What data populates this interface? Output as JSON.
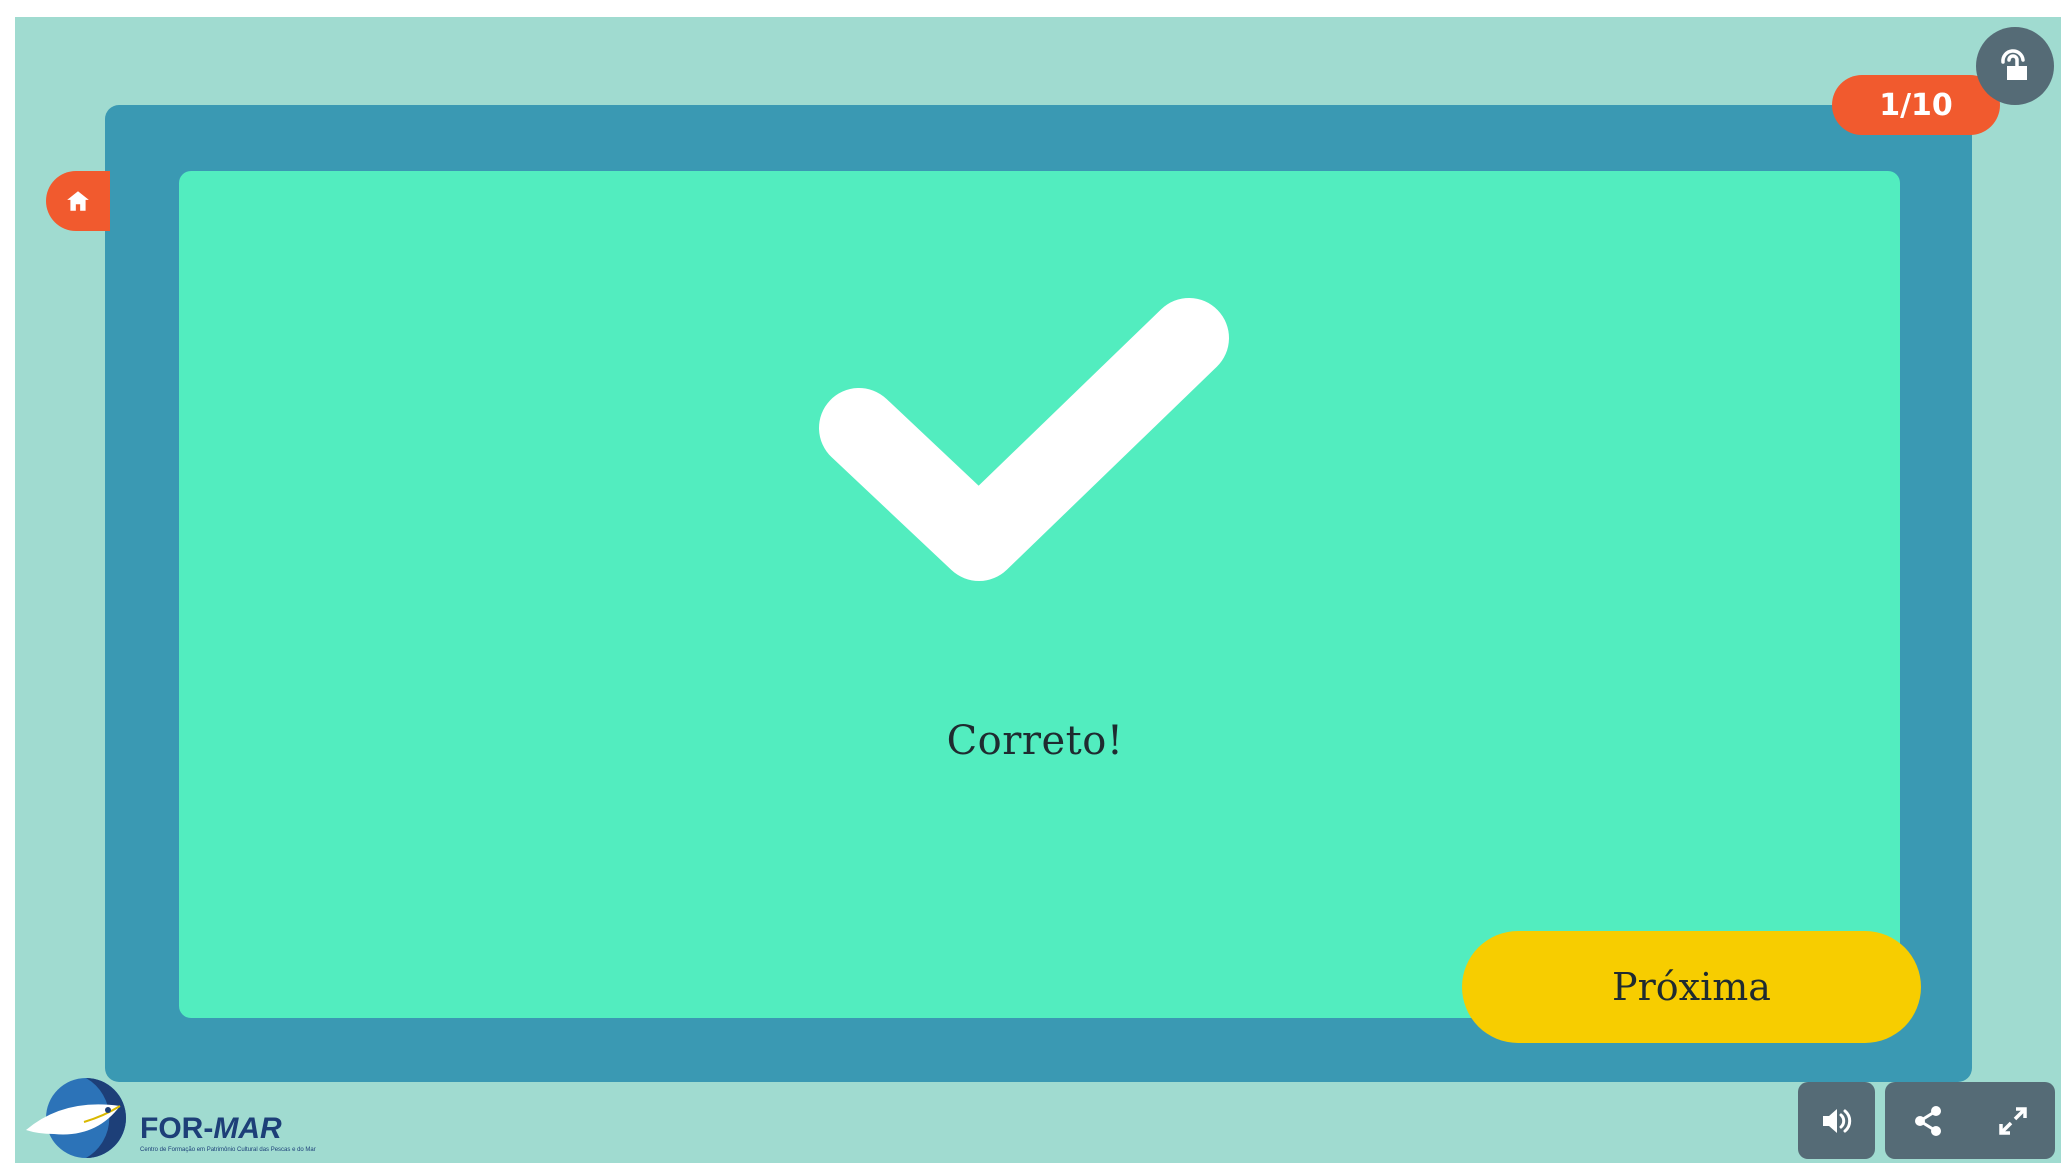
{
  "counter": {
    "text": "1/10"
  },
  "feedback": {
    "text": "Correto!"
  },
  "next_button": {
    "label": "Próxima"
  },
  "logo": {
    "name_part1": "FOR-",
    "name_part2": "MAR",
    "subtitle": "Centro de Formação em Patrimônio Cultural das Pescas e do Mar"
  },
  "icons": {
    "touch": "touch-lock-icon",
    "home": "home-icon",
    "sound": "speaker-icon",
    "share": "share-icon",
    "fullscreen": "expand-icon",
    "result": "checkmark-icon"
  },
  "colors": {
    "stage_bg": "#a0dbd0",
    "frame_bg": "#3a99b3",
    "card_bg": "#52edbf",
    "accent_orange": "#f15a2e",
    "button_yellow": "#f7cd00",
    "control_gray": "#556b76",
    "logo_blue": "#1d3f78"
  }
}
